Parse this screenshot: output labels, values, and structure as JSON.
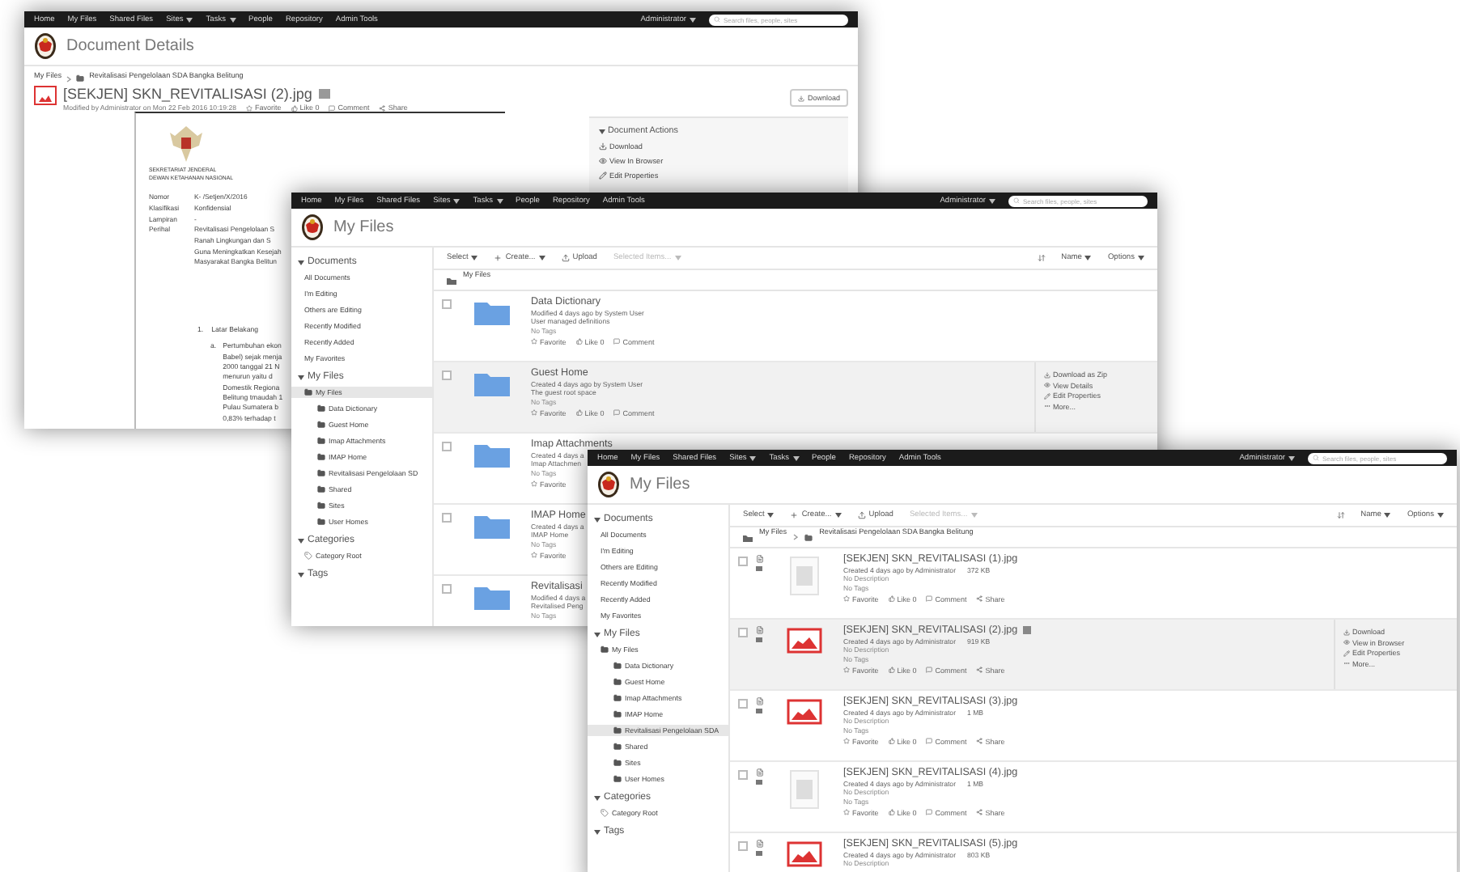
{
  "windows": [
    {
      "kind": "document-details",
      "nav": {
        "items": [
          {
            "label": "Home",
            "dropdown": false
          },
          {
            "label": "My Files",
            "dropdown": false
          },
          {
            "label": "Shared Files",
            "dropdown": false
          },
          {
            "label": "Sites",
            "dropdown": true
          },
          {
            "label": "Tasks",
            "dropdown": true
          },
          {
            "label": "People",
            "dropdown": false
          },
          {
            "label": "Repository",
            "dropdown": false
          },
          {
            "label": "Admin Tools",
            "dropdown": false
          }
        ],
        "user": "Administrator",
        "search_placeholder": "Search files, people, sites"
      },
      "title": "Document Details",
      "breadcrumb": [
        "My Files",
        "Revitalisasi Pengelolaan SDA Bangka Belitung"
      ],
      "file": {
        "name": "[SEKJEN] SKN_REVITALISASI (2).jpg",
        "meta": "Modified by Administrator on Mon 22 Feb 2016 10:19:28",
        "actions": [
          {
            "kind": "favorite",
            "label": "Favorite"
          },
          {
            "kind": "like",
            "label": "Like 0"
          },
          {
            "kind": "comment",
            "label": "Comment"
          },
          {
            "kind": "share",
            "label": "Share"
          }
        ]
      },
      "download": "Download",
      "panel": {
        "title": "Document Actions",
        "expanded": true,
        "actions": [
          {
            "kind": "download",
            "label": "Download"
          },
          {
            "kind": "view",
            "label": "View In Browser"
          },
          {
            "kind": "edit",
            "label": "Edit Properties"
          }
        ]
      },
      "letter": {
        "heading": [
          "SEKRETARIAT JENDERAL",
          "DEWAN KETAHANAN NASIONAL"
        ],
        "fields": [
          {
            "label": "Nomor",
            "value": "K-   /Setjen/X/2016"
          },
          {
            "label": "Klasifikasi",
            "value": "Konfidensial"
          },
          {
            "label": "Lampiran",
            "value": "-"
          },
          {
            "label": "Perihal",
            "value": "Revitalisasi Pengelolaan S"
          }
        ],
        "subject_lines": [
          "Ranah Lingkungan dan S",
          "Guna Meningkatkan Kesejah",
          "Masyarakat Bangka Belitun"
        ],
        "section": {
          "number": "1.",
          "title": "Latar Belakang"
        },
        "item": {
          "marker": "a.",
          "lines": [
            "Pertumbuhan ekon",
            "Babel) sejak menja",
            "2000 tanggal 21 N",
            "menurun yaitu d",
            "Domestik Regiona",
            "Belitung tmaudah 1",
            "Pulau Sumatera b",
            "0,83% terhadap t"
          ]
        }
      }
    },
    {
      "kind": "file-list",
      "nav": {
        "items": [
          {
            "label": "Home",
            "dropdown": false
          },
          {
            "label": "My Files",
            "dropdown": false
          },
          {
            "label": "Shared Files",
            "dropdown": false
          },
          {
            "label": "Sites",
            "dropdown": true
          },
          {
            "label": "Tasks",
            "dropdown": true
          },
          {
            "label": "People",
            "dropdown": false
          },
          {
            "label": "Repository",
            "dropdown": false
          },
          {
            "label": "Admin Tools",
            "dropdown": false
          }
        ],
        "user": "Administrator",
        "search_placeholder": "Search files, people, sites"
      },
      "title": "My Files",
      "sidebar": [
        {
          "title": "Documents",
          "expanded": true,
          "items": [
            {
              "kind": "link",
              "label": "All Documents",
              "selected": false
            },
            {
              "kind": "link",
              "label": "I'm Editing",
              "selected": false
            },
            {
              "kind": "link",
              "label": "Others are Editing",
              "selected": false
            },
            {
              "kind": "link",
              "label": "Recently Modified",
              "selected": false
            },
            {
              "kind": "link",
              "label": "Recently Added",
              "selected": false
            },
            {
              "kind": "link",
              "label": "My Favorites",
              "selected": false
            }
          ]
        },
        {
          "title": "My Files",
          "expanded": true,
          "items": [
            {
              "kind": "folder",
              "label": "My Files",
              "selected": true,
              "children": [
                {
                  "kind": "folder",
                  "label": "Data Dictionary",
                  "selected": false
                },
                {
                  "kind": "folder",
                  "label": "Guest Home",
                  "selected": false
                },
                {
                  "kind": "folder",
                  "label": "Imap Attachments",
                  "selected": false
                },
                {
                  "kind": "folder",
                  "label": "IMAP Home",
                  "selected": false
                },
                {
                  "kind": "folder",
                  "label": "Revitalisasi Pengelolaan SD",
                  "selected": false
                },
                {
                  "kind": "folder",
                  "label": "Shared",
                  "selected": false
                },
                {
                  "kind": "folder",
                  "label": "Sites",
                  "selected": false
                },
                {
                  "kind": "folder",
                  "label": "User Homes",
                  "selected": false
                }
              ]
            }
          ]
        },
        {
          "title": "Categories",
          "expanded": true,
          "items": [
            {
              "kind": "category",
              "label": "Category Root",
              "selected": false
            }
          ]
        },
        {
          "title": "Tags",
          "expanded": true
        }
      ],
      "toolbar": {
        "left": [
          {
            "kind": "menu",
            "label": "Select",
            "disabled": false
          },
          {
            "kind": "create",
            "label": "Create...",
            "disabled": false
          },
          {
            "kind": "upload",
            "label": "Upload",
            "disabled": false
          },
          {
            "kind": "menu",
            "label": "Selected Items...",
            "disabled": true
          }
        ],
        "sort": "Name",
        "options": "Options"
      },
      "breadcrumb": [
        "My Files"
      ],
      "rows": [
        {
          "kind": "folder",
          "name": "Data Dictionary",
          "meta": "Modified 4 days ago by System User",
          "description": "User managed definitions",
          "tags": "No Tags",
          "checked": false,
          "selected": false,
          "actions": [
            {
              "kind": "favorite",
              "label": "Favorite"
            },
            {
              "kind": "like",
              "label": "Like 0"
            },
            {
              "kind": "comment",
              "label": "Comment"
            }
          ],
          "side_actions": []
        },
        {
          "kind": "folder",
          "name": "Guest Home",
          "meta": "Created 4 days ago by System User",
          "description": "The guest root space",
          "tags": "No Tags",
          "checked": false,
          "selected": true,
          "actions": [
            {
              "kind": "favorite",
              "label": "Favorite"
            },
            {
              "kind": "like",
              "label": "Like 0"
            },
            {
              "kind": "comment",
              "label": "Comment"
            }
          ],
          "side_actions": [
            {
              "kind": "download",
              "label": "Download as Zip"
            },
            {
              "kind": "view",
              "label": "View Details"
            },
            {
              "kind": "edit",
              "label": "Edit Properties"
            },
            {
              "kind": "more",
              "label": "More..."
            }
          ]
        },
        {
          "kind": "folder",
          "name": "Imap Attachments",
          "meta": "Created 4 days a",
          "description": "Imap Attachmen",
          "tags": "No Tags",
          "checked": false,
          "selected": false,
          "actions": [
            {
              "kind": "favorite",
              "label": "Favorite"
            }
          ],
          "side_actions": []
        },
        {
          "kind": "folder",
          "name": "IMAP Home",
          "meta": "Created 4 days a",
          "description": "IMAP Home",
          "tags": "No Tags",
          "checked": false,
          "selected": false,
          "actions": [
            {
              "kind": "favorite",
              "label": "Favorite"
            }
          ],
          "side_actions": []
        },
        {
          "kind": "folder",
          "name": "Revitalisasi",
          "meta": "Modified 4 days a",
          "description": "Revitalised Peng",
          "tags": "No Tags",
          "checked": false,
          "selected": false,
          "actions": [],
          "side_actions": []
        }
      ]
    },
    {
      "kind": "file-list",
      "nav": {
        "items": [
          {
            "label": "Home",
            "dropdown": false
          },
          {
            "label": "My Files",
            "dropdown": false
          },
          {
            "label": "Shared Files",
            "dropdown": false
          },
          {
            "label": "Sites",
            "dropdown": true
          },
          {
            "label": "Tasks",
            "dropdown": true
          },
          {
            "label": "People",
            "dropdown": false
          },
          {
            "label": "Repository",
            "dropdown": false
          },
          {
            "label": "Admin Tools",
            "dropdown": false
          }
        ],
        "user": "Administrator",
        "search_placeholder": "Search files, people, sites"
      },
      "title": "My Files",
      "sidebar": [
        {
          "title": "Documents",
          "expanded": true,
          "items": [
            {
              "kind": "link",
              "label": "All Documents",
              "selected": false
            },
            {
              "kind": "link",
              "label": "I'm Editing",
              "selected": false
            },
            {
              "kind": "link",
              "label": "Others are Editing",
              "selected": false
            },
            {
              "kind": "link",
              "label": "Recently Modified",
              "selected": false
            },
            {
              "kind": "link",
              "label": "Recently Added",
              "selected": false
            },
            {
              "kind": "link",
              "label": "My Favorites",
              "selected": false
            }
          ]
        },
        {
          "title": "My Files",
          "expanded": true,
          "items": [
            {
              "kind": "folder",
              "label": "My Files",
              "selected": false,
              "children": [
                {
                  "kind": "folder",
                  "label": "Data Dictionary",
                  "selected": false
                },
                {
                  "kind": "folder",
                  "label": "Guest Home",
                  "selected": false
                },
                {
                  "kind": "folder",
                  "label": "Imap Attachments",
                  "selected": false
                },
                {
                  "kind": "folder",
                  "label": "IMAP Home",
                  "selected": false
                },
                {
                  "kind": "folder",
                  "label": "Revitalisasi Pengelolaan SDA",
                  "selected": true
                },
                {
                  "kind": "folder",
                  "label": "Shared",
                  "selected": false
                },
                {
                  "kind": "folder",
                  "label": "Sites",
                  "selected": false
                },
                {
                  "kind": "folder",
                  "label": "User Homes",
                  "selected": false
                }
              ]
            }
          ]
        },
        {
          "title": "Categories",
          "expanded": true,
          "items": [
            {
              "kind": "category",
              "label": "Category Root",
              "selected": false
            }
          ]
        },
        {
          "title": "Tags",
          "expanded": true
        }
      ],
      "toolbar": {
        "left": [
          {
            "kind": "menu",
            "label": "Select",
            "disabled": false
          },
          {
            "kind": "create",
            "label": "Create...",
            "disabled": false
          },
          {
            "kind": "upload",
            "label": "Upload",
            "disabled": false
          },
          {
            "kind": "menu",
            "label": "Selected Items...",
            "disabled": true
          }
        ],
        "sort": "Name",
        "options": "Options"
      },
      "breadcrumb": [
        "My Files",
        "Revitalisasi Pengelolaan SDA Bangka Belitung"
      ],
      "rows": [
        {
          "kind": "document",
          "name": "[SEKJEN] SKN_REVITALISASI (1).jpg",
          "meta": "Created 4 days ago by Administrator",
          "size": "372 KB",
          "description": "No Description",
          "tags": "No Tags",
          "checked": false,
          "selected": false,
          "actions": [
            {
              "kind": "favorite",
              "label": "Favorite"
            },
            {
              "kind": "like",
              "label": "Like 0"
            },
            {
              "kind": "comment",
              "label": "Comment"
            },
            {
              "kind": "share",
              "label": "Share"
            }
          ],
          "side_actions": []
        },
        {
          "kind": "image",
          "name": "[SEKJEN] SKN_REVITALISASI (2).jpg",
          "meta": "Created 4 days ago by Administrator",
          "size": "919 KB",
          "description": "No Description",
          "tags": "No Tags",
          "checked": false,
          "selected": true,
          "actions": [
            {
              "kind": "favorite",
              "label": "Favorite"
            },
            {
              "kind": "like",
              "label": "Like 0"
            },
            {
              "kind": "comment",
              "label": "Comment"
            },
            {
              "kind": "share",
              "label": "Share"
            }
          ],
          "side_actions": [
            {
              "kind": "download",
              "label": "Download"
            },
            {
              "kind": "view",
              "label": "View in Browser"
            },
            {
              "kind": "edit",
              "label": "Edit Properties"
            },
            {
              "kind": "more",
              "label": "More..."
            }
          ]
        },
        {
          "kind": "image",
          "name": "[SEKJEN] SKN_REVITALISASI (3).jpg",
          "meta": "Created 4 days ago by Administrator",
          "size": "1 MB",
          "description": "No Description",
          "tags": "No Tags",
          "checked": false,
          "selected": false,
          "actions": [
            {
              "kind": "favorite",
              "label": "Favorite"
            },
            {
              "kind": "like",
              "label": "Like 0"
            },
            {
              "kind": "comment",
              "label": "Comment"
            },
            {
              "kind": "share",
              "label": "Share"
            }
          ],
          "side_actions": []
        },
        {
          "kind": "document",
          "name": "[SEKJEN] SKN_REVITALISASI (4).jpg",
          "meta": "Created 4 days ago by Administrator",
          "size": "1 MB",
          "description": "No Description",
          "tags": "No Tags",
          "checked": false,
          "selected": false,
          "actions": [
            {
              "kind": "favorite",
              "label": "Favorite"
            },
            {
              "kind": "like",
              "label": "Like 0"
            },
            {
              "kind": "comment",
              "label": "Comment"
            },
            {
              "kind": "share",
              "label": "Share"
            }
          ],
          "side_actions": []
        },
        {
          "kind": "image",
          "name": "[SEKJEN] SKN_REVITALISASI (5).jpg",
          "meta": "Created 4 days ago by Administrator",
          "size": "803 KB",
          "description": "No Description",
          "checked": false,
          "selected": false,
          "actions": [],
          "side_actions": []
        }
      ]
    }
  ]
}
